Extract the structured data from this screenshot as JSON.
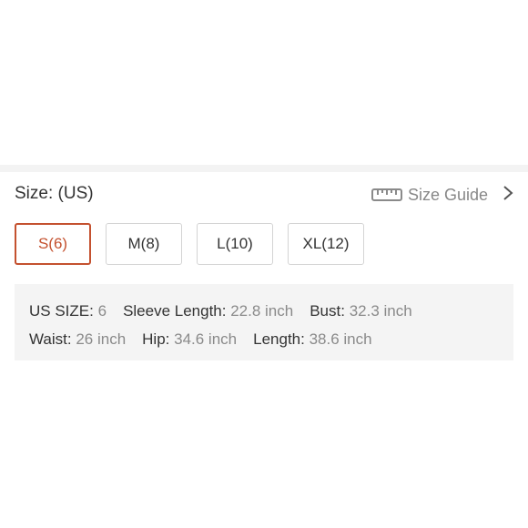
{
  "size_selector": {
    "title": "Size: (US)",
    "size_guide_label": "Size Guide",
    "options": [
      {
        "label": "S(6)",
        "selected": true
      },
      {
        "label": "M(8)",
        "selected": false
      },
      {
        "label": "L(10)",
        "selected": false
      },
      {
        "label": "XL(12)",
        "selected": false
      }
    ]
  },
  "measurements": {
    "us_size": {
      "key": "US SIZE:",
      "value": "6"
    },
    "sleeve_length": {
      "key": "Sleeve Length:",
      "value": "22.8 inch"
    },
    "bust": {
      "key": "Bust:",
      "value": "32.3 inch"
    },
    "waist": {
      "key": "Waist:",
      "value": "26 inch"
    },
    "hip": {
      "key": "Hip:",
      "value": "34.6 inch"
    },
    "length": {
      "key": "Length:",
      "value": "38.6 inch"
    }
  },
  "colors": {
    "accent": "#c4512f",
    "border": "#d4d4d4",
    "panel_bg": "#f4f4f4",
    "muted_text": "#8a8a8a"
  },
  "icons": {
    "ruler": "ruler-icon",
    "chevron": "chevron-right-icon"
  }
}
